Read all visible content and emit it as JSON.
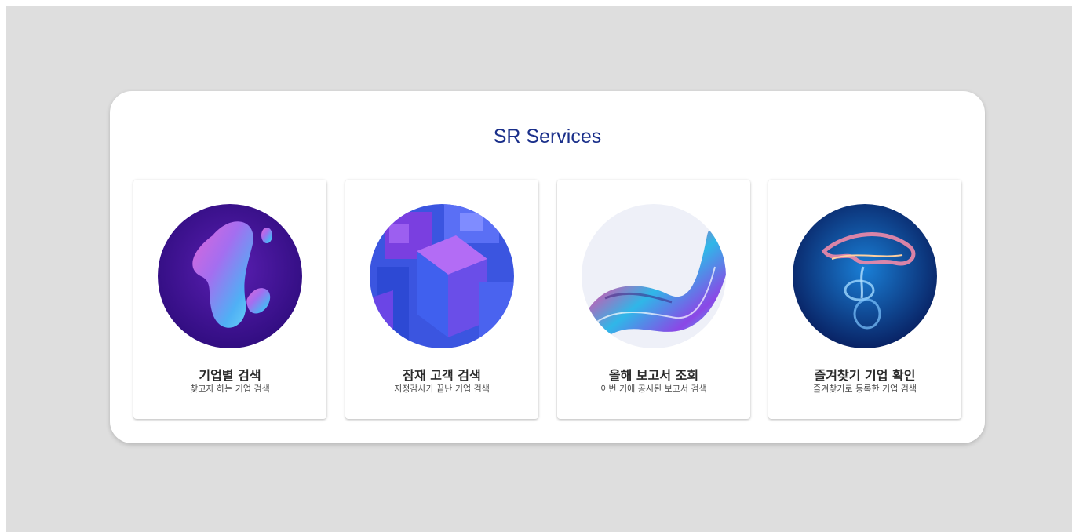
{
  "page": {
    "title": "SR Services",
    "background": "#dedede",
    "title_color": "#1a2f8a"
  },
  "cards": [
    {
      "title": "기업별 검색",
      "description": "찾고자 하는 기업 검색",
      "icon": "liquid-blob-art"
    },
    {
      "title": "잠재 고객 검색",
      "description": "지정감사가 끝난 기업 검색",
      "icon": "cube-blocks-art"
    },
    {
      "title": "올해 보고서 조회",
      "description": "이번 기에 공시된 보고서 검색",
      "icon": "iridescent-ribbon-art"
    },
    {
      "title": "즐겨찾기 기업 확인",
      "description": "즐겨찾기로 등록한 기업 검색",
      "icon": "glass-swirl-art"
    }
  ]
}
